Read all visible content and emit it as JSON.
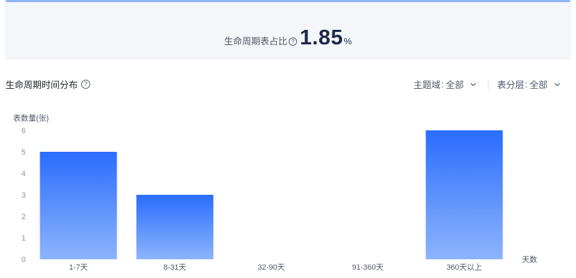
{
  "kpi": {
    "label": "生命周期表占比",
    "help_icon": "question-circle-icon",
    "value": "1.85",
    "unit": "%"
  },
  "section": {
    "title": "生命周期时间分布",
    "help_icon": "question-circle-icon"
  },
  "filters": [
    {
      "label": "主题域",
      "value": "全部",
      "icon": "chevron-down-icon"
    },
    {
      "label": "表分层",
      "value": "全部",
      "icon": "chevron-down-icon"
    }
  ],
  "filter_separator": ":",
  "colors": {
    "bar_top": "#2a6dfd",
    "bar_bottom": "#8db4fc",
    "kpi_border": "#8fb4f6",
    "axis_text": "#86909c"
  },
  "chart_data": {
    "type": "bar",
    "ylabel": "表数量(张)",
    "xlabel": "天数",
    "categories": [
      "1-7天",
      "8-31天",
      "32-90天",
      "91-360天",
      "360天以上"
    ],
    "values": [
      5,
      3,
      0,
      0,
      6
    ],
    "ylim": [
      0,
      6
    ],
    "yticks": [
      "0",
      "1",
      "2",
      "3",
      "4",
      "5",
      "6"
    ],
    "grid": false,
    "legend": "none"
  }
}
